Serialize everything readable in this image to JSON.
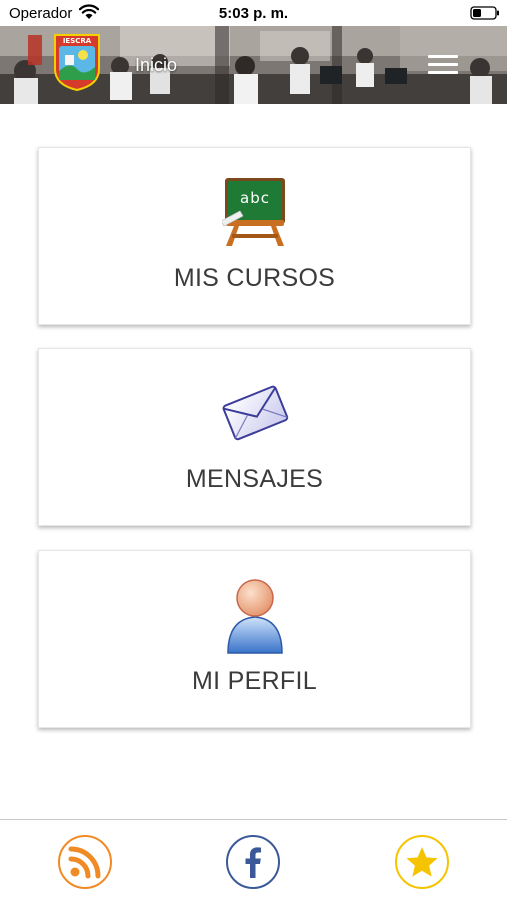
{
  "status_bar": {
    "carrier": "Operador",
    "time": "5:03 p. m.",
    "icons": [
      "wifi-icon",
      "battery-icon"
    ]
  },
  "header": {
    "title": "Inicio",
    "logo_text": "IESCRA",
    "icons": [
      "menu-icon"
    ]
  },
  "cards": [
    {
      "label": "MIS CURSOS",
      "icon": "chalkboard-icon",
      "icon_text": "abc"
    },
    {
      "label": "MENSAJES",
      "icon": "envelope-icon"
    },
    {
      "label": "MI PERFIL",
      "icon": "user-profile-icon"
    }
  ],
  "bottom_bar": {
    "buttons": [
      {
        "icon": "rss-icon",
        "color": "#f08a24"
      },
      {
        "icon": "facebook-icon",
        "color": "#3b5998"
      },
      {
        "icon": "star-icon",
        "color": "#f5c400"
      }
    ]
  }
}
